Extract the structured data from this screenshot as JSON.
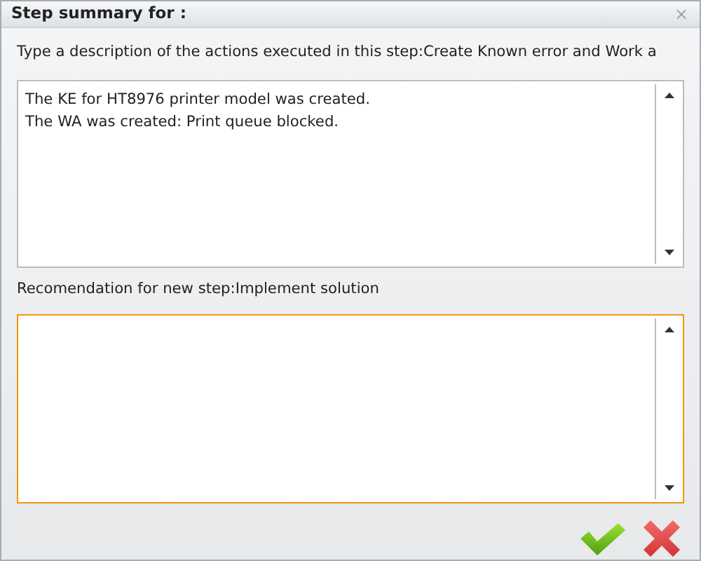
{
  "window": {
    "title": "Step summary for :",
    "close": "⨯"
  },
  "fields": [
    {
      "label": "Type a description of the actions executed in this step:Create Known error and Work a",
      "value": "The KE for HT8976 printer model was created.\nThe WA was created: Print queue blocked.",
      "focused": false
    },
    {
      "label": "Recomendation for new step:Implement solution",
      "focused": true
    }
  ],
  "buttons": [
    {
      "kind": "ok"
    },
    {
      "kind": "cancel"
    }
  ]
}
